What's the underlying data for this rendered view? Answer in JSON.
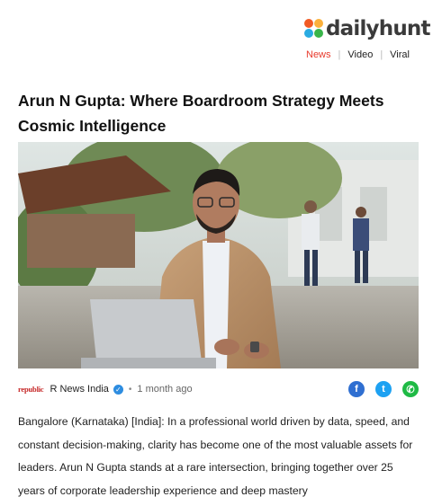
{
  "header": {
    "logo_text": "dailyhunt",
    "logo_colors": [
      "#f15a24",
      "#fbb03b",
      "#29abe2",
      "#39b54a"
    ],
    "nav": [
      {
        "label": "News",
        "active": true
      },
      {
        "label": "Video",
        "active": false
      },
      {
        "label": "Viral",
        "active": false
      }
    ]
  },
  "article": {
    "title": "Arun N Gupta: Where Boardroom Strategy Meets Cosmic Intelligence",
    "image_icon": "portrait-photo",
    "publisher_logo_text": "republic",
    "publisher": "R News India",
    "verified_icon": "verified-badge-icon",
    "published": "1 month ago",
    "share": [
      {
        "name": "facebook-share-icon",
        "glyph": "f",
        "color": "#2f6fd1"
      },
      {
        "name": "twitter-share-icon",
        "glyph": "t",
        "color": "#1da1f2"
      },
      {
        "name": "whatsapp-share-icon",
        "glyph": "w",
        "color": "#1fba45"
      }
    ],
    "body": "Bangalore (Karnataka) [India]: In a professional world driven by data, speed, and constant decision-making, clarity has become one of the most valuable assets for leaders. Arun N Gupta stands at a rare intersection, bringing together over 25 years of corporate leadership experience and deep mastery"
  }
}
